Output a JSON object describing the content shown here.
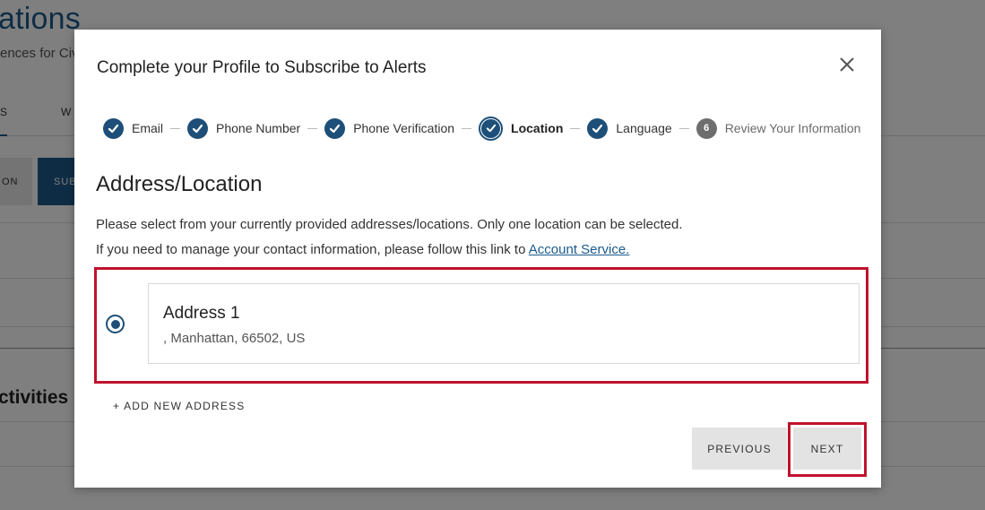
{
  "background": {
    "title": "ations",
    "subtitle": "ences for Civ",
    "tabs": [
      "S",
      "W"
    ],
    "buttons": [
      "ON",
      "SUB"
    ],
    "section_heading": "ctivities"
  },
  "modal": {
    "title": "Complete your Profile to Subscribe to Alerts",
    "close_icon": "close-icon",
    "steps": [
      {
        "label": "Email",
        "status": "completed"
      },
      {
        "label": "Phone Number",
        "status": "completed"
      },
      {
        "label": "Phone Verification",
        "status": "completed"
      },
      {
        "label": "Location",
        "status": "current"
      },
      {
        "label": "Language",
        "status": "completed"
      },
      {
        "label": "Review Your Information",
        "status": "pending",
        "number": "6"
      }
    ],
    "section_heading": "Address/Location",
    "description_1": "Please select from your currently provided addresses/locations. Only one location can be selected.",
    "description_2_prefix": "If you need to manage your contact information, please follow this link to ",
    "description_2_link": "Account Service.",
    "addresses": [
      {
        "name": "Address 1",
        "detail": ", Manhattan, 66502, US",
        "selected": true
      }
    ],
    "add_new_label": "+ ADD NEW ADDRESS",
    "previous_label": "PREVIOUS",
    "next_label": "NEXT"
  },
  "colors": {
    "primary": "#1d4f78",
    "highlight": "#c0122e",
    "pending_step": "#6e6e6e",
    "link": "#1a5a8c",
    "button_bg": "#e3e3e3"
  }
}
